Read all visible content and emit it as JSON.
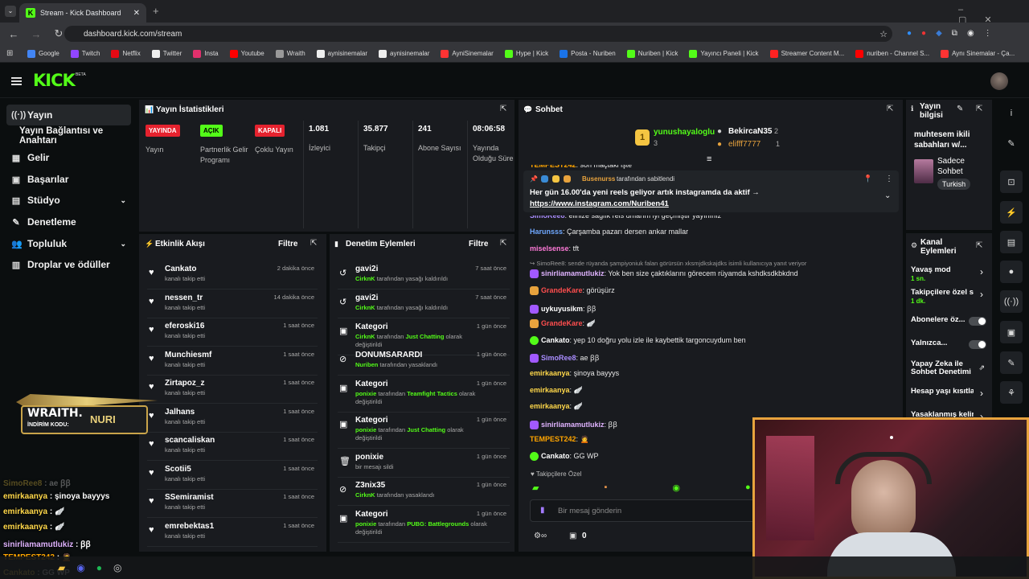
{
  "browser": {
    "tab_title": "Stream - Kick Dashboard",
    "url": "dashboard.kick.com/stream"
  },
  "bookmarks": [
    "Google",
    "Twitch",
    "Netflix",
    "Twitter",
    "Insta",
    "Youtube",
    "Wraith",
    "aynisinemalar",
    "aynisinemalar",
    "AyniSinemalar",
    "Hype | Kick",
    "Posta - Nuriben",
    "Nuriben | Kick",
    "Yayıncı Paneli | Kick",
    "Streamer Content M...",
    "nuriben - Channel S...",
    "Aynı Sinemalar - Ça..."
  ],
  "bookmark_colors": [
    "#4285f4",
    "#9146ff",
    "#e50914",
    "#eeeeee",
    "#e1306c",
    "#ff0000",
    "#999999",
    "#eeeeee",
    "#eeeeee",
    "#ff3333",
    "#53fc18",
    "#1a73e8",
    "#53fc18",
    "#53fc18",
    "#ff2222",
    "#ff0000",
    "#ff3333"
  ],
  "brand": {
    "logo": "KICK",
    "beta": "BETA",
    "accent": "#53fc18"
  },
  "sidebar": {
    "items": [
      {
        "label": "Yayın",
        "icon": "broadcast-icon",
        "glyph": "((·))",
        "active": true
      },
      {
        "label": "Yayın Bağlantısı ve Anahtarı",
        "icon": "",
        "glyph": ""
      },
      {
        "label": "Gelir",
        "icon": "revenue-icon",
        "glyph": "▦"
      },
      {
        "label": "Başarılar",
        "icon": "achievements-icon",
        "glyph": "▣"
      },
      {
        "label": "Stüdyo",
        "icon": "studio-icon",
        "glyph": "▤",
        "chevron": "⌄"
      },
      {
        "label": "Denetleme",
        "icon": "moderation-icon",
        "glyph": "✎"
      },
      {
        "label": "Topluluk",
        "icon": "community-icon",
        "glyph": "👥",
        "chevron": "⌄"
      },
      {
        "label": "Droplar ve ödüller",
        "icon": "drops-icon",
        "glyph": "▥"
      }
    ]
  },
  "stats": {
    "title": "Yayın İstatistikleri",
    "cols": [
      {
        "badge": "YAYINDA",
        "badge_bg": "#e5222e",
        "badge_fg": "#ffffff",
        "label": "Yayın"
      },
      {
        "badge": "AÇIK",
        "badge_bg": "#53fc18",
        "badge_fg": "#000000",
        "label": "Partnerlik Gelir Programı"
      },
      {
        "badge": "KAPALI",
        "badge_bg": "#e5222e",
        "badge_fg": "#ffffff",
        "label": "Çoklu Yayın"
      },
      {
        "value": "1.081",
        "label": "İzleyici"
      },
      {
        "value": "35.877",
        "label": "Takipçi"
      },
      {
        "value": "241",
        "label": "Abone Sayısı"
      },
      {
        "value": "08:06:58",
        "label": "Yayında Olduğu Süre"
      }
    ]
  },
  "activity": {
    "title": "Etkinlik Akışı",
    "filter": "Filtre",
    "items": [
      {
        "name": "Cankato",
        "sub": "kanalı takip etti",
        "time": "2 dakika önce"
      },
      {
        "name": "nessen_tr",
        "sub": "kanalı takip etti",
        "time": "14 dakika önce"
      },
      {
        "name": "eferoski16",
        "sub": "kanalı takip etti",
        "time": "1 saat önce"
      },
      {
        "name": "Munchiesmf",
        "sub": "kanalı takip etti",
        "time": "1 saat önce"
      },
      {
        "name": "Zirtapoz_z",
        "sub": "kanalı takip etti",
        "time": "1 saat önce"
      },
      {
        "name": "Jalhans",
        "sub": "kanalı takip etti",
        "time": "1 saat önce"
      },
      {
        "name": "scancaliskan",
        "sub": "kanalı takip etti",
        "time": "1 saat önce"
      },
      {
        "name": "Scotii5",
        "sub": "kanalı takip etti",
        "time": "1 saat önce"
      },
      {
        "name": "SSemiramist",
        "sub": "kanalı takip etti",
        "time": "1 saat önce"
      },
      {
        "name": "emrebektas1",
        "sub": "kanalı takip etti",
        "time": "1 saat önce"
      }
    ]
  },
  "modlog": {
    "title": "Denetim Eylemleri",
    "filter": "Filtre",
    "items": [
      {
        "icon": "↺",
        "name": "gavi2i",
        "actor": "CirknK",
        "sub": " tarafından yasağı kaldırıldı",
        "time": "7 saat önce"
      },
      {
        "icon": "↺",
        "name": "gavi2i",
        "actor": "CirknK",
        "sub": " tarafından yasağı kaldırıldı",
        "time": "7 saat önce"
      },
      {
        "icon": "▣",
        "name": "Kategori",
        "actor": "CirknK",
        "sub": " tarafından ",
        "cat": "Just Chatting",
        "sub2": " olarak değiştirildi",
        "time": "1 gün önce"
      },
      {
        "icon": "⊘",
        "name": "DONUMSARARDI",
        "actor": "Nuriben",
        "sub": " tarafından yasaklandı",
        "time": "1 gün önce"
      },
      {
        "icon": "▣",
        "name": "Kategori",
        "actor": "ponixie",
        "sub": " tarafından ",
        "cat": "Teamfight Tactics",
        "sub2": " olarak değiştirildi",
        "time": "1 gün önce"
      },
      {
        "icon": "▣",
        "name": "Kategori",
        "actor": "ponixie",
        "sub": " tarafından ",
        "cat": "Just Chatting",
        "sub2": " olarak değiştirildi",
        "time": "1 gün önce"
      },
      {
        "icon": "🗑",
        "name": "ponixie",
        "actor": "",
        "sub": "bir mesajı sildi",
        "time": "1 gün önce"
      },
      {
        "icon": "⊘",
        "name": "Z3nix35",
        "actor": "CirknK",
        "sub": " tarafından yasaklandı",
        "time": "1 gün önce"
      },
      {
        "icon": "▣",
        "name": "Kategori",
        "actor": "ponixie",
        "sub": " tarafından ",
        "cat": "PUBG: Battlegrounds",
        "sub2": " olarak değiştirildi",
        "time": "1 gün önce"
      }
    ]
  },
  "chat": {
    "title": "Sohbet",
    "top_gifters": [
      {
        "name": "yunushayaloglu",
        "count": "3"
      },
      {
        "name": "BekircaN35",
        "count": "2"
      },
      {
        "name": "elifff7777",
        "count": "1"
      }
    ],
    "pinned": {
      "by": "Busenurss",
      "by_suffix": " tarafından sabitlendi",
      "text": "Her gün 16.00'da yeni reels geliyor artık instagramda da aktif →",
      "link": "https://www.instagram.com/Nuriben41"
    },
    "messages": [
      {
        "user": "TEMPEST242",
        "color": "#ffa500",
        "text": "son maçtaki işte"
      },
      {
        "user": "SimoRee8",
        "color": "#a98dff",
        "text": "elinize sağlık reis umarım iyi geçmiştir yayınınız"
      },
      {
        "user": "Harunsss",
        "color": "#6fa8ff",
        "text": "Çarşamba pazarı dersen ankar mallar"
      },
      {
        "user": "miselsense",
        "color": "#ff7ad9",
        "text": "tft"
      },
      {
        "user": "",
        "color": "#9a9a9a",
        "text": "↪ SimoRee8: sende rüyanda şampiyoniuk falan görürsün xksmjdkskajdks isimli kullanıcıya yanıt veriyor"
      },
      {
        "user": "sinirliamamutlukiz",
        "color": "#e0b3ff",
        "text": "Yok ben size çaktıklarını görecem rüyamda kshdksdkbkdnd"
      },
      {
        "user": "GrandeKare",
        "color": "#ff4e4e",
        "text": "görüşürz"
      },
      {
        "user": "uykuyusikm",
        "color": "#ffffff",
        "text": "ꞵꞵ"
      },
      {
        "user": "GrandeKare",
        "color": "#ff4e4e",
        "text": "🪽"
      },
      {
        "user": "Cankato",
        "color": "#ffffff",
        "text": "yep 10 doğru yolu izle ile kaybettik targoncuydum ben"
      },
      {
        "user": "SimoRee8",
        "color": "#a98dff",
        "text": "ae ꞵꞵ"
      },
      {
        "user": "emirkaanya",
        "color": "#ffd84a",
        "text": "şinoya bayyys"
      },
      {
        "user": "emirkaanya",
        "color": "#ffd84a",
        "text": "🪽"
      },
      {
        "user": "emirkaanya",
        "color": "#ffd84a",
        "text": "🪽"
      },
      {
        "user": "sinirliamamutlukiz",
        "color": "#e0b3ff",
        "text": "ꞵꞵ"
      },
      {
        "user": "TEMPEST242",
        "color": "#ffa500",
        "text": "🙍"
      },
      {
        "user": "Cankato",
        "color": "#ffffff",
        "text": "GG WP"
      }
    ],
    "followers_only": "Takipçilere Özel",
    "placeholder": "Bir mesaj gönderin",
    "points": "0"
  },
  "stream_info": {
    "title": "Yayın bilgisi",
    "stream_title": "muhtesem ikili sabahları w/...",
    "category": "Sadece Sohbet",
    "language": "Turkish"
  },
  "channel_actions": {
    "title": "Kanal Eylemleri",
    "items": [
      {
        "label": "Yavaş mod",
        "sub": "1 sn.",
        "type": "chevron"
      },
      {
        "label": "Takipçilere özel s",
        "sub": "1 dk.",
        "type": "chevron"
      },
      {
        "label": "Abonelere öz...",
        "type": "toggle"
      },
      {
        "label": "Yalnızca...",
        "type": "toggle"
      },
      {
        "label": "Yapay Zeka ile Sohbet Denetimi",
        "type": "link"
      },
      {
        "label": "Hesap yaşı kısıtla",
        "type": "chevron"
      },
      {
        "label": "Yasaklanmış kelin",
        "type": "chevron"
      }
    ]
  },
  "overlay": {
    "promo": "WRAITH.",
    "promo_code_label": "İNDİRİM KODU:",
    "promo_code": "NURI",
    "lines": [
      {
        "user": "SimoRee8",
        "text": "ae ꞵꞵ"
      },
      {
        "user": "emirkaanya",
        "text": "şinoya bayyys"
      },
      {
        "user": "emirkaanya",
        "text": "🪽"
      },
      {
        "user": "emirkaanya",
        "text": "🪽"
      },
      {
        "user": "sinirliamamutlukiz",
        "text": "ꞵꞵ"
      },
      {
        "user": "TEMPEST242",
        "text": "🙍"
      },
      {
        "user": "Cankato",
        "text": "GG WP"
      }
    ]
  }
}
